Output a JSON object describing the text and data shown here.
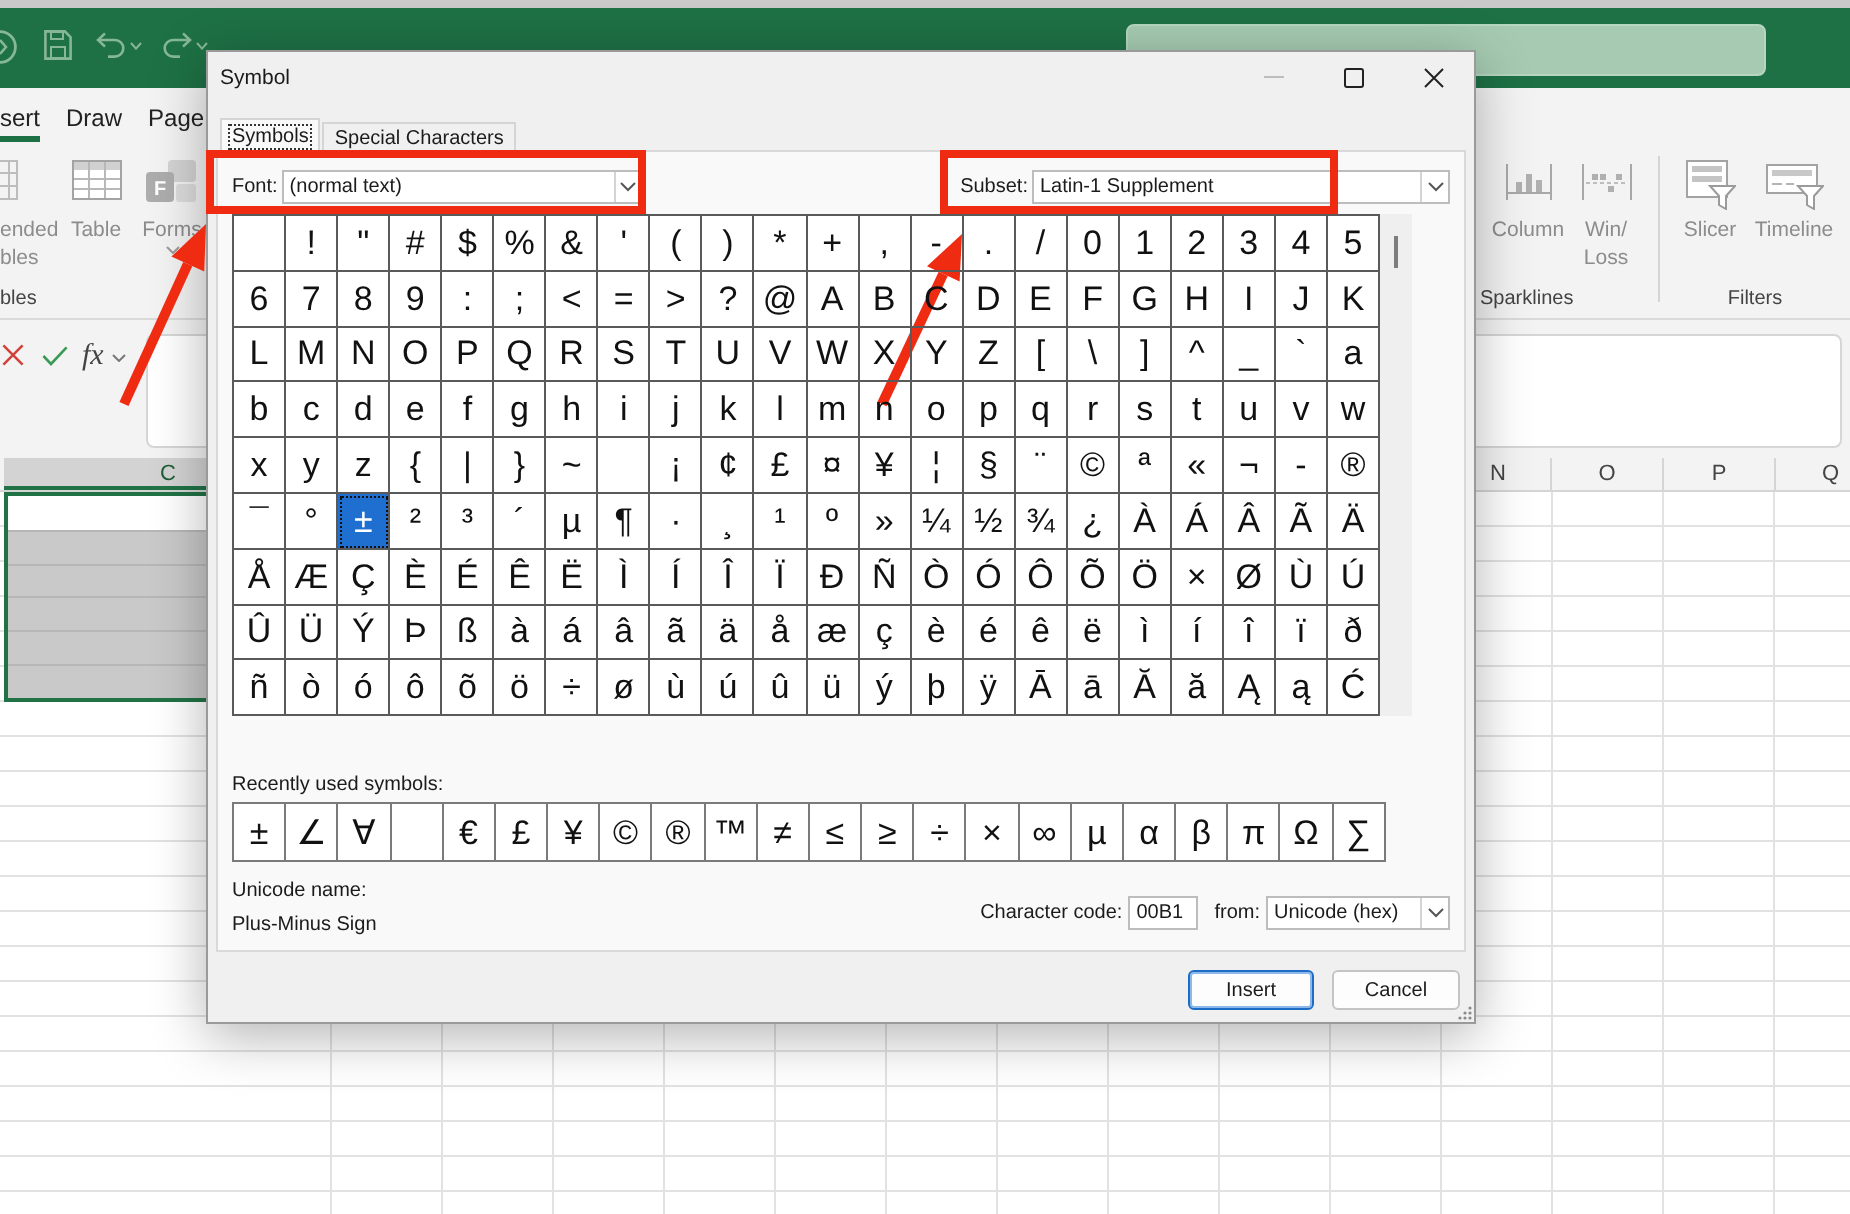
{
  "excel": {
    "ribbon_tabs": [
      {
        "label": "sert",
        "selected": true
      },
      {
        "label": "Draw",
        "selected": false
      },
      {
        "label": "Page",
        "selected": false
      }
    ],
    "ribbon_groups": [
      {
        "label": "bles",
        "items": [
          {
            "label": "ended\nbles",
            "disabled": true,
            "dropdown": false
          },
          {
            "label": "Table",
            "disabled": true,
            "dropdown": false
          },
          {
            "label": "Forms",
            "badge": "F",
            "disabled": true,
            "dropdown": true
          }
        ]
      },
      {
        "label": "Sparklines",
        "items": [
          {
            "label": "Column",
            "disabled": true,
            "dropdown": false
          },
          {
            "label": "Win/\nLoss",
            "disabled": true,
            "dropdown": false
          }
        ]
      },
      {
        "label": "Filters",
        "items": [
          {
            "label": "Slicer",
            "disabled": true,
            "dropdown": false
          },
          {
            "label": "Timeline",
            "disabled": true,
            "dropdown": false
          }
        ]
      }
    ],
    "formula_bar": {
      "function_label": "fx"
    },
    "column_headers": [
      {
        "label": "C",
        "selected": true
      },
      {
        "label": "N",
        "selected": false
      },
      {
        "label": "O",
        "selected": false
      },
      {
        "label": "P",
        "selected": false
      },
      {
        "label": "Q",
        "selected": false
      }
    ],
    "selected_cells": [
      {
        "active": true
      },
      {
        "active": false
      },
      {
        "active": false
      },
      {
        "active": false
      },
      {
        "active": false
      },
      {
        "active": false
      }
    ]
  },
  "dialog": {
    "title": "Symbol",
    "window_buttons": [
      {
        "kind": "minimize",
        "disabled": true
      },
      {
        "kind": "maximize",
        "disabled": false
      },
      {
        "kind": "close",
        "disabled": false
      }
    ],
    "tabs": [
      {
        "label": "Symbols",
        "selected": true
      },
      {
        "label": "Special Characters",
        "selected": false
      }
    ],
    "font": {
      "label": "Font:",
      "value": "(normal text)",
      "highlighted": true
    },
    "subset": {
      "label": "Subset:",
      "value": "Latin-1 Supplement",
      "highlighted": true
    },
    "symbol_rows": [
      [
        {
          "selected": false
        },
        {
          "symbol": "!",
          "selected": false
        },
        {
          "symbol": "\"",
          "selected": false
        },
        {
          "symbol": "#",
          "selected": false
        },
        {
          "symbol": "$",
          "selected": false
        },
        {
          "symbol": "%",
          "selected": false
        },
        {
          "symbol": "&",
          "selected": false
        },
        {
          "symbol": "'",
          "selected": false
        },
        {
          "symbol": "(",
          "selected": false
        },
        {
          "symbol": ")",
          "selected": false
        },
        {
          "symbol": "*",
          "selected": false
        },
        {
          "symbol": "+",
          "selected": false
        },
        {
          "symbol": ",",
          "selected": false
        },
        {
          "symbol": "-",
          "selected": false
        },
        {
          "symbol": ".",
          "selected": false
        },
        {
          "symbol": "/",
          "selected": false
        },
        {
          "symbol": "0",
          "selected": false
        },
        {
          "symbol": "1",
          "selected": false
        },
        {
          "symbol": "2",
          "selected": false
        },
        {
          "symbol": "3",
          "selected": false
        },
        {
          "symbol": "4",
          "selected": false
        },
        {
          "symbol": "5",
          "selected": false
        }
      ],
      [
        {
          "symbol": "6",
          "selected": false
        },
        {
          "symbol": "7",
          "selected": false
        },
        {
          "symbol": "8",
          "selected": false
        },
        {
          "symbol": "9",
          "selected": false
        },
        {
          "symbol": ":",
          "selected": false
        },
        {
          "symbol": ";",
          "selected": false
        },
        {
          "symbol": "<",
          "selected": false
        },
        {
          "symbol": "=",
          "selected": false
        },
        {
          "symbol": ">",
          "selected": false
        },
        {
          "symbol": "?",
          "selected": false
        },
        {
          "symbol": "@",
          "selected": false
        },
        {
          "symbol": "A",
          "selected": false
        },
        {
          "symbol": "B",
          "selected": false
        },
        {
          "symbol": "C",
          "selected": false
        },
        {
          "symbol": "D",
          "selected": false
        },
        {
          "symbol": "E",
          "selected": false
        },
        {
          "symbol": "F",
          "selected": false
        },
        {
          "symbol": "G",
          "selected": false
        },
        {
          "symbol": "H",
          "selected": false
        },
        {
          "symbol": "I",
          "selected": false
        },
        {
          "symbol": "J",
          "selected": false
        },
        {
          "symbol": "K",
          "selected": false
        }
      ],
      [
        {
          "symbol": "L",
          "selected": false
        },
        {
          "symbol": "M",
          "selected": false
        },
        {
          "symbol": "N",
          "selected": false
        },
        {
          "symbol": "O",
          "selected": false
        },
        {
          "symbol": "P",
          "selected": false
        },
        {
          "symbol": "Q",
          "selected": false
        },
        {
          "symbol": "R",
          "selected": false
        },
        {
          "symbol": "S",
          "selected": false
        },
        {
          "symbol": "T",
          "selected": false
        },
        {
          "symbol": "U",
          "selected": false
        },
        {
          "symbol": "V",
          "selected": false
        },
        {
          "symbol": "W",
          "selected": false
        },
        {
          "symbol": "X",
          "selected": false
        },
        {
          "symbol": "Y",
          "selected": false
        },
        {
          "symbol": "Z",
          "selected": false
        },
        {
          "symbol": "[",
          "selected": false
        },
        {
          "symbol": "\\",
          "selected": false
        },
        {
          "symbol": "]",
          "selected": false
        },
        {
          "symbol": "^",
          "selected": false
        },
        {
          "symbol": "_",
          "selected": false
        },
        {
          "symbol": "`",
          "selected": false
        },
        {
          "symbol": "a",
          "selected": false
        }
      ],
      [
        {
          "symbol": "b",
          "selected": false
        },
        {
          "symbol": "c",
          "selected": false
        },
        {
          "symbol": "d",
          "selected": false
        },
        {
          "symbol": "e",
          "selected": false
        },
        {
          "symbol": "f",
          "selected": false
        },
        {
          "symbol": "g",
          "selected": false
        },
        {
          "symbol": "h",
          "selected": false
        },
        {
          "symbol": "i",
          "selected": false
        },
        {
          "symbol": "j",
          "selected": false
        },
        {
          "symbol": "k",
          "selected": false
        },
        {
          "symbol": "l",
          "selected": false
        },
        {
          "symbol": "m",
          "selected": false
        },
        {
          "symbol": "n",
          "selected": false
        },
        {
          "symbol": "o",
          "selected": false
        },
        {
          "symbol": "p",
          "selected": false
        },
        {
          "symbol": "q",
          "selected": false
        },
        {
          "symbol": "r",
          "selected": false
        },
        {
          "symbol": "s",
          "selected": false
        },
        {
          "symbol": "t",
          "selected": false
        },
        {
          "symbol": "u",
          "selected": false
        },
        {
          "symbol": "v",
          "selected": false
        },
        {
          "symbol": "w",
          "selected": false
        }
      ],
      [
        {
          "symbol": "x",
          "selected": false
        },
        {
          "symbol": "y",
          "selected": false
        },
        {
          "symbol": "z",
          "selected": false
        },
        {
          "symbol": "{",
          "selected": false
        },
        {
          "symbol": "|",
          "selected": false
        },
        {
          "symbol": "}",
          "selected": false
        },
        {
          "symbol": "~",
          "selected": false
        },
        {
          "selected": false
        },
        {
          "symbol": "¡",
          "selected": false
        },
        {
          "symbol": "¢",
          "selected": false
        },
        {
          "symbol": "£",
          "selected": false
        },
        {
          "symbol": "¤",
          "selected": false
        },
        {
          "symbol": "¥",
          "selected": false
        },
        {
          "symbol": "¦",
          "selected": false
        },
        {
          "symbol": "§",
          "selected": false
        },
        {
          "symbol": "¨",
          "selected": false
        },
        {
          "symbol": "©",
          "selected": false
        },
        {
          "symbol": "ª",
          "selected": false
        },
        {
          "symbol": "«",
          "selected": false
        },
        {
          "symbol": "¬",
          "selected": false
        },
        {
          "symbol": "-",
          "selected": false
        },
        {
          "symbol": "®",
          "selected": false
        }
      ],
      [
        {
          "symbol": "¯",
          "selected": false
        },
        {
          "symbol": "°",
          "selected": false
        },
        {
          "symbol": "±",
          "selected": true
        },
        {
          "symbol": "²",
          "selected": false
        },
        {
          "symbol": "³",
          "selected": false
        },
        {
          "symbol": "´",
          "selected": false
        },
        {
          "symbol": "µ",
          "selected": false
        },
        {
          "symbol": "¶",
          "selected": false
        },
        {
          "symbol": "·",
          "selected": false
        },
        {
          "symbol": "¸",
          "selected": false
        },
        {
          "symbol": "¹",
          "selected": false
        },
        {
          "symbol": "º",
          "selected": false
        },
        {
          "symbol": "»",
          "selected": false
        },
        {
          "symbol": "¼",
          "selected": false
        },
        {
          "symbol": "½",
          "selected": false
        },
        {
          "symbol": "¾",
          "selected": false
        },
        {
          "symbol": "¿",
          "selected": false
        },
        {
          "symbol": "À",
          "selected": false
        },
        {
          "symbol": "Á",
          "selected": false
        },
        {
          "symbol": "Â",
          "selected": false
        },
        {
          "symbol": "Ã",
          "selected": false
        },
        {
          "symbol": "Ä",
          "selected": false
        }
      ],
      [
        {
          "symbol": "Å",
          "selected": false
        },
        {
          "symbol": "Æ",
          "selected": false
        },
        {
          "symbol": "Ç",
          "selected": false
        },
        {
          "symbol": "È",
          "selected": false
        },
        {
          "symbol": "É",
          "selected": false
        },
        {
          "symbol": "Ê",
          "selected": false
        },
        {
          "symbol": "Ë",
          "selected": false
        },
        {
          "symbol": "Ì",
          "selected": false
        },
        {
          "symbol": "Í",
          "selected": false
        },
        {
          "symbol": "Î",
          "selected": false
        },
        {
          "symbol": "Ï",
          "selected": false
        },
        {
          "symbol": "Ð",
          "selected": false
        },
        {
          "symbol": "Ñ",
          "selected": false
        },
        {
          "symbol": "Ò",
          "selected": false
        },
        {
          "symbol": "Ó",
          "selected": false
        },
        {
          "symbol": "Ô",
          "selected": false
        },
        {
          "symbol": "Õ",
          "selected": false
        },
        {
          "symbol": "Ö",
          "selected": false
        },
        {
          "symbol": "×",
          "selected": false
        },
        {
          "symbol": "Ø",
          "selected": false
        },
        {
          "symbol": "Ù",
          "selected": false
        },
        {
          "symbol": "Ú",
          "selected": false
        }
      ],
      [
        {
          "symbol": "Û",
          "selected": false
        },
        {
          "symbol": "Ü",
          "selected": false
        },
        {
          "symbol": "Ý",
          "selected": false
        },
        {
          "symbol": "Þ",
          "selected": false
        },
        {
          "symbol": "ß",
          "selected": false
        },
        {
          "symbol": "à",
          "selected": false
        },
        {
          "symbol": "á",
          "selected": false
        },
        {
          "symbol": "â",
          "selected": false
        },
        {
          "symbol": "ã",
          "selected": false
        },
        {
          "symbol": "ä",
          "selected": false
        },
        {
          "symbol": "å",
          "selected": false
        },
        {
          "symbol": "æ",
          "selected": false
        },
        {
          "symbol": "ç",
          "selected": false
        },
        {
          "symbol": "è",
          "selected": false
        },
        {
          "symbol": "é",
          "selected": false
        },
        {
          "symbol": "ê",
          "selected": false
        },
        {
          "symbol": "ë",
          "selected": false
        },
        {
          "symbol": "ì",
          "selected": false
        },
        {
          "symbol": "í",
          "selected": false
        },
        {
          "symbol": "î",
          "selected": false
        },
        {
          "symbol": "ï",
          "selected": false
        },
        {
          "symbol": "ð",
          "selected": false
        }
      ],
      [
        {
          "symbol": "ñ",
          "selected": false
        },
        {
          "symbol": "ò",
          "selected": false
        },
        {
          "symbol": "ó",
          "selected": false
        },
        {
          "symbol": "ô",
          "selected": false
        },
        {
          "symbol": "õ",
          "selected": false
        },
        {
          "symbol": "ö",
          "selected": false
        },
        {
          "symbol": "÷",
          "selected": false
        },
        {
          "symbol": "ø",
          "selected": false
        },
        {
          "symbol": "ù",
          "selected": false
        },
        {
          "symbol": "ú",
          "selected": false
        },
        {
          "symbol": "û",
          "selected": false
        },
        {
          "symbol": "ü",
          "selected": false
        },
        {
          "symbol": "ý",
          "selected": false
        },
        {
          "symbol": "þ",
          "selected": false
        },
        {
          "symbol": "ÿ",
          "selected": false
        },
        {
          "symbol": "Ā",
          "selected": false
        },
        {
          "symbol": "ā",
          "selected": false
        },
        {
          "symbol": "Ă",
          "selected": false
        },
        {
          "symbol": "ă",
          "selected": false
        },
        {
          "symbol": "Ą",
          "selected": false
        },
        {
          "symbol": "ą",
          "selected": false
        },
        {
          "symbol": "Ć",
          "selected": false
        }
      ]
    ],
    "recent_label": "Recently used symbols:",
    "recent_symbols": [
      {
        "symbol": "±",
        "selected": false
      },
      {
        "symbol": "∠",
        "selected": false
      },
      {
        "symbol": "∀",
        "selected": false
      },
      {
        "selected": false
      },
      {
        "symbol": "€",
        "selected": false
      },
      {
        "symbol": "£",
        "selected": false
      },
      {
        "symbol": "¥",
        "selected": false
      },
      {
        "symbol": "©",
        "selected": false
      },
      {
        "symbol": "®",
        "selected": false
      },
      {
        "symbol": "™",
        "selected": false
      },
      {
        "symbol": "≠",
        "selected": false
      },
      {
        "symbol": "≤",
        "selected": false
      },
      {
        "symbol": "≥",
        "selected": false
      },
      {
        "symbol": "÷",
        "selected": false
      },
      {
        "symbol": "×",
        "selected": false
      },
      {
        "symbol": "∞",
        "selected": false
      },
      {
        "symbol": "µ",
        "selected": false
      },
      {
        "symbol": "α",
        "selected": false
      },
      {
        "symbol": "β",
        "selected": false
      },
      {
        "symbol": "π",
        "selected": false
      },
      {
        "symbol": "Ω",
        "selected": false
      },
      {
        "symbol": "∑",
        "selected": false
      }
    ],
    "unicode_name_label": "Unicode name:",
    "unicode_name": "Plus-Minus Sign",
    "character_code": {
      "label": "Character code:",
      "value": "00B1"
    },
    "from": {
      "label": "from:",
      "value": "Unicode (hex)"
    },
    "buttons": [
      {
        "label": "Insert",
        "default": true
      },
      {
        "label": "Cancel",
        "default": false
      }
    ]
  }
}
